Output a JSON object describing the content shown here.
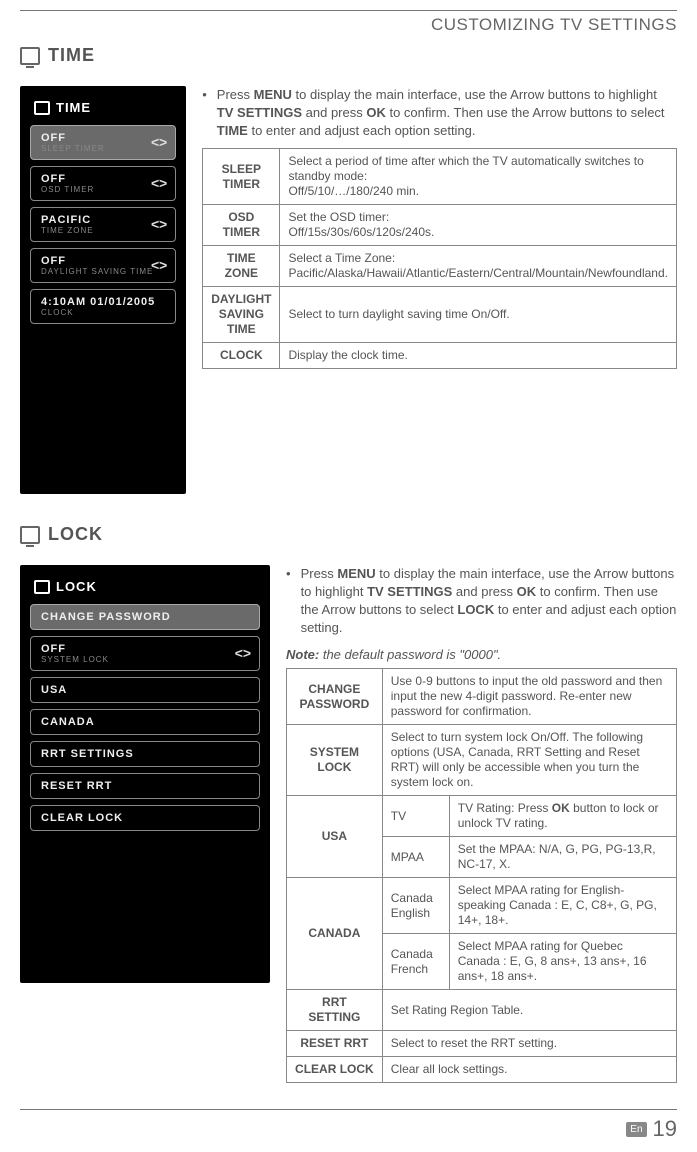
{
  "header": {
    "title": "CUSTOMIZING TV SETTINGS"
  },
  "time": {
    "heading": "TIME",
    "screen_title": "TIME",
    "menu": [
      {
        "value": "OFF",
        "label": "SLEEP TIMER",
        "arrows": true,
        "selected": true
      },
      {
        "value": "OFF",
        "label": "OSD TIMER",
        "arrows": true
      },
      {
        "value": "PACIFIC",
        "label": "TIME ZONE",
        "arrows": true
      },
      {
        "value": "OFF",
        "label": "DAYLIGHT SAVING TIME",
        "arrows": true
      },
      {
        "value": "4:10AM 01/01/2005",
        "label": "CLOCK",
        "arrows": false
      }
    ],
    "instr_parts": {
      "p1": "Press ",
      "b1": "MENU",
      "p2": " to display the main interface, use the Arrow buttons to highlight ",
      "b2": "TV SETTINGS",
      "p3": " and press ",
      "b3": "OK",
      "p4": " to confirm. Then use the Arrow buttons to select ",
      "b4": "TIME",
      "p5": " to enter and adjust each option setting."
    },
    "rows": [
      {
        "key": "SLEEP TIMER",
        "desc": "Select a period of time after which the TV automatically switches to standby mode:\nOff/5/10/…/180/240 min."
      },
      {
        "key": "OSD TIMER",
        "desc": "Set the OSD timer:\nOff/15s/30s/60s/120s/240s."
      },
      {
        "key": "TIME ZONE",
        "desc": "Select a Time Zone:\nPacific/Alaska/Hawaii/Atlantic/Eastern/Central/Mountain/Newfoundland."
      },
      {
        "key": "DAYLIGHT SAVING TIME",
        "desc": "Select to turn daylight saving time On/Off."
      },
      {
        "key": "CLOCK",
        "desc": "Display the clock time."
      }
    ]
  },
  "lock": {
    "heading": "LOCK",
    "screen_title": "LOCK",
    "menu": [
      {
        "value": "CHANGE PASSWORD",
        "label": "",
        "arrows": false,
        "selected": true
      },
      {
        "value": "OFF",
        "label": "SYSTEM LOCK",
        "arrows": true
      },
      {
        "value": "USA",
        "label": "",
        "arrows": false
      },
      {
        "value": "CANADA",
        "label": "",
        "arrows": false
      },
      {
        "value": "RRT SETTINGS",
        "label": "",
        "arrows": false
      },
      {
        "value": "RESET RRT",
        "label": "",
        "arrows": false
      },
      {
        "value": "CLEAR LOCK",
        "label": "",
        "arrows": false
      }
    ],
    "instr_parts": {
      "p1": "Press ",
      "b1": "MENU",
      "p2": " to display the main interface, use the Arrow buttons to highlight ",
      "b2": "TV SETTINGS",
      "p3": " and press ",
      "b3": "OK",
      "p4": " to confirm. Then use the Arrow buttons to select ",
      "b4": "LOCK",
      "p5": " to enter and adjust each option setting."
    },
    "note_label": "Note:",
    "note_text": " the default password is \"0000\".",
    "rows": {
      "change_pw": {
        "key": "CHANGE PASSWORD",
        "desc": "Use 0-9 buttons to input the old password and then input the new 4-digit password. Re-enter new password for confirmation."
      },
      "system_lock": {
        "key": "SYSTEM LOCK",
        "desc": "Select to turn system lock On/Off. The following options (USA, Canada, RRT Setting and Reset RRT) will only be accessible when you turn the system lock on."
      },
      "usa": {
        "key": "USA",
        "tv": {
          "sub": "TV",
          "d1": "TV Rating: Press ",
          "b": "OK",
          "d2": " button to lock or unlock TV rating."
        },
        "mpaa": {
          "sub": "MPAA",
          "desc": "Set the MPAA: N/A, G, PG, PG-13,R, NC-17, X."
        }
      },
      "canada": {
        "key": "CANADA",
        "eng": {
          "sub": "Canada English",
          "desc": "Select MPAA rating for English-speaking Canada : E, C, C8+, G, PG, 14+, 18+."
        },
        "fr": {
          "sub": "Canada French",
          "desc": "Select MPAA rating for Quebec Canada : E, G, 8 ans+, 13 ans+, 16 ans+, 18 ans+."
        }
      },
      "rrt": {
        "key": "RRT SETTING",
        "desc": "Set Rating Region Table."
      },
      "reset": {
        "key": "RESET RRT",
        "desc": "Select to reset the RRT setting."
      },
      "clear": {
        "key": "CLEAR LOCK",
        "desc": "Clear all lock settings."
      }
    }
  },
  "footer": {
    "lang": "En",
    "page": "19"
  }
}
